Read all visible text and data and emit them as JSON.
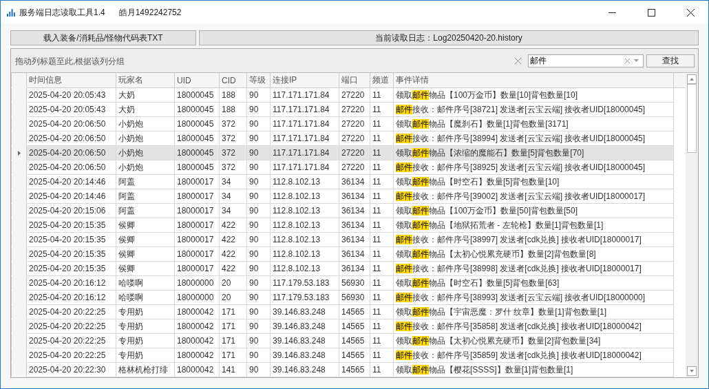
{
  "window": {
    "title": "服务端日志读取工具1.4",
    "author": "皓月1492242752"
  },
  "toolbar": {
    "load_button": "载入装备/消耗品/怪物代码表TXT",
    "current_log": "当前读取日志：Log20250420-20.history"
  },
  "group_panel": {
    "hint": "拖动列标题至此,根据该列分组",
    "search": {
      "value": "邮件"
    },
    "find_button": "查找"
  },
  "table": {
    "columns": [
      "时间信息",
      "玩家名",
      "UID",
      "CID",
      "等级",
      "连接IP",
      "端口",
      "频道",
      "事件详情"
    ],
    "rows": [
      {
        "time": "2025-04-20 20:05:43",
        "player": "大奶",
        "uid": "18000045",
        "cid": "188",
        "level": "90",
        "ip": "117.171.171.84",
        "port": "27220",
        "channel": "11",
        "detail": {
          "before": "领取",
          "match": "邮件",
          "after": "物品【100万金币】数量[10]背包数量[10]"
        },
        "selected": false
      },
      {
        "time": "2025-04-20 20:05:43",
        "player": "大奶",
        "uid": "18000045",
        "cid": "188",
        "level": "90",
        "ip": "117.171.171.84",
        "port": "27220",
        "channel": "11",
        "detail": {
          "match": "邮件",
          "after": "接收：邮件序号[38721] 发送者[云宝云端] 接收者UID[18000045]"
        },
        "selected": false
      },
      {
        "time": "2025-04-20 20:06:50",
        "player": "小奶炮",
        "uid": "18000045",
        "cid": "372",
        "level": "90",
        "ip": "117.171.171.84",
        "port": "27220",
        "channel": "11",
        "detail": {
          "before": "领取",
          "match": "邮件",
          "after": "物品【魔刹石】数量[1]背包数量[3171]"
        },
        "selected": false
      },
      {
        "time": "2025-04-20 20:06:50",
        "player": "小奶炮",
        "uid": "18000045",
        "cid": "372",
        "level": "90",
        "ip": "117.171.171.84",
        "port": "27220",
        "channel": "11",
        "detail": {
          "match": "邮件",
          "after": "接收：邮件序号[38994] 发送者[云宝云端] 接收者UID[18000045]"
        },
        "selected": false
      },
      {
        "time": "2025-04-20 20:06:50",
        "player": "小奶炮",
        "uid": "18000045",
        "cid": "372",
        "level": "90",
        "ip": "117.171.171.84",
        "port": "27220",
        "channel": "11",
        "detail": {
          "before": "领取",
          "match": "邮件",
          "after": "物品【浓缩的魔能石】数量[5]背包数量[70]"
        },
        "selected": true
      },
      {
        "time": "2025-04-20 20:06:50",
        "player": "小奶炮",
        "uid": "18000045",
        "cid": "372",
        "level": "90",
        "ip": "117.171.171.84",
        "port": "27220",
        "channel": "11",
        "detail": {
          "match": "邮件",
          "after": "接收：邮件序号[38925] 发送者[云宝云端] 接收者UID[18000045]"
        },
        "selected": false
      },
      {
        "time": "2025-04-20 20:14:46",
        "player": "阿盖",
        "uid": "18000017",
        "cid": "34",
        "level": "90",
        "ip": "112.8.102.13",
        "port": "36134",
        "channel": "11",
        "detail": {
          "before": "领取",
          "match": "邮件",
          "after": "物品【时空石】数量[5]背包数量[10]"
        },
        "selected": false
      },
      {
        "time": "2025-04-20 20:14:46",
        "player": "阿盖",
        "uid": "18000017",
        "cid": "34",
        "level": "90",
        "ip": "112.8.102.13",
        "port": "36134",
        "channel": "11",
        "detail": {
          "match": "邮件",
          "after": "接收：邮件序号[39002] 发送者[云宝云端] 接收者UID[18000017]"
        },
        "selected": false
      },
      {
        "time": "2025-04-20 20:15:06",
        "player": "阿盖",
        "uid": "18000017",
        "cid": "34",
        "level": "90",
        "ip": "112.8.102.13",
        "port": "36134",
        "channel": "11",
        "detail": {
          "before": "领取",
          "match": "邮件",
          "after": "物品【100万金币】数量[50]背包数量[50]"
        },
        "selected": false
      },
      {
        "time": "2025-04-20 20:15:35",
        "player": "侯卿",
        "uid": "18000017",
        "cid": "422",
        "level": "90",
        "ip": "112.8.102.13",
        "port": "36134",
        "channel": "11",
        "detail": {
          "before": "领取",
          "match": "邮件",
          "after": "物品【地狱拓荒者 - 左轮枪】数量[1]背包数量[1]"
        },
        "selected": false
      },
      {
        "time": "2025-04-20 20:15:35",
        "player": "侯卿",
        "uid": "18000017",
        "cid": "422",
        "level": "90",
        "ip": "112.8.102.13",
        "port": "36134",
        "channel": "11",
        "detail": {
          "match": "邮件",
          "after": "接收：邮件序号[38997] 发送者[cdk兑换] 接收者UID[18000017]"
        },
        "selected": false
      },
      {
        "time": "2025-04-20 20:15:35",
        "player": "侯卿",
        "uid": "18000017",
        "cid": "422",
        "level": "90",
        "ip": "112.8.102.13",
        "port": "36134",
        "channel": "11",
        "detail": {
          "before": "领取",
          "match": "邮件",
          "after": "物品【太初心悦累充硬币】数量[2]背包数量[8]"
        },
        "selected": false
      },
      {
        "time": "2025-04-20 20:15:35",
        "player": "侯卿",
        "uid": "18000017",
        "cid": "422",
        "level": "90",
        "ip": "112.8.102.13",
        "port": "36134",
        "channel": "11",
        "detail": {
          "match": "邮件",
          "after": "接收：邮件序号[38998] 发送者[cdk兑换] 接收者UID[18000017]"
        },
        "selected": false
      },
      {
        "time": "2025-04-20 20:16:12",
        "player": "哈喽啊",
        "uid": "18000000",
        "cid": "20",
        "level": "90",
        "ip": "117.179.53.183",
        "port": "56930",
        "channel": "11",
        "detail": {
          "before": "领取",
          "match": "邮件",
          "after": "物品【时空石】数量[5]背包数量[63]"
        },
        "selected": false
      },
      {
        "time": "2025-04-20 20:16:12",
        "player": "哈喽啊",
        "uid": "18000000",
        "cid": "20",
        "level": "90",
        "ip": "117.179.53.183",
        "port": "56930",
        "channel": "11",
        "detail": {
          "match": "邮件",
          "after": "接收：邮件序号[38993] 发送者[云宝云端] 接收者UID[18000000]"
        },
        "selected": false
      },
      {
        "time": "2025-04-20 20:22:25",
        "player": "专用奶",
        "uid": "18000042",
        "cid": "171",
        "level": "90",
        "ip": "39.146.83.248",
        "port": "14565",
        "channel": "11",
        "detail": {
          "before": "领取",
          "match": "邮件",
          "after": "物品【宇宙恶魔：罗什 纹章】数量[1]背包数量[1]"
        },
        "selected": false
      },
      {
        "time": "2025-04-20 20:22:25",
        "player": "专用奶",
        "uid": "18000042",
        "cid": "171",
        "level": "90",
        "ip": "39.146.83.248",
        "port": "14565",
        "channel": "11",
        "detail": {
          "match": "邮件",
          "after": "接收：邮件序号[35858] 发送者[cdk兑换] 接收者UID[18000042]"
        },
        "selected": false
      },
      {
        "time": "2025-04-20 20:22:25",
        "player": "专用奶",
        "uid": "18000042",
        "cid": "171",
        "level": "90",
        "ip": "39.146.83.248",
        "port": "14565",
        "channel": "11",
        "detail": {
          "before": "领取",
          "match": "邮件",
          "after": "物品【太初心悦累充硬币】数量[2]背包数量[34]"
        },
        "selected": false
      },
      {
        "time": "2025-04-20 20:22:25",
        "player": "专用奶",
        "uid": "18000042",
        "cid": "171",
        "level": "90",
        "ip": "39.146.83.248",
        "port": "14565",
        "channel": "11",
        "detail": {
          "match": "邮件",
          "after": "接收：邮件序号[35859] 发送者[cdk兑换] 接收者UID[18000042]"
        },
        "selected": false
      },
      {
        "time": "2025-04-20 20:22:30",
        "player": "格林机枪打绯",
        "uid": "18000042",
        "cid": "141",
        "level": "90",
        "ip": "39.146.83.248",
        "port": "14565",
        "channel": "11",
        "detail": {
          "before": "领取",
          "match": "邮件",
          "after": "物品【樱花[SSSS]】数量[1]背包数量[1]"
        },
        "selected": false
      }
    ]
  }
}
